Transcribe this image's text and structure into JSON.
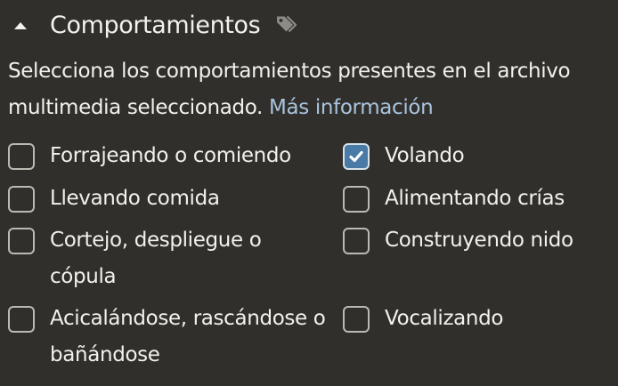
{
  "section": {
    "title": "Comportamientos",
    "description": "Selecciona los comportamientos presentes en el archivo multimedia seleccionado.",
    "more_info_link": "Más información"
  },
  "behaviors": {
    "foraging": {
      "label": "Forrajeando o comiendo",
      "checked": false
    },
    "flying": {
      "label": "Volando",
      "checked": true
    },
    "carrying_food": {
      "label": "Llevando comida",
      "checked": false
    },
    "feeding_young": {
      "label": "Alimentando crías",
      "checked": false
    },
    "courtship": {
      "label": "Cortejo, despliegue o cópula",
      "checked": false
    },
    "nest_building": {
      "label": "Construyendo nido",
      "checked": false
    },
    "preening": {
      "label": "Acicalándose, rascándose o bañándose",
      "checked": false
    },
    "vocalizing": {
      "label": "Vocalizando",
      "checked": false
    }
  },
  "icons": {
    "collapse": "caret-up-icon",
    "tag": "tag-icon",
    "check": "checkmark-icon"
  },
  "colors": {
    "background": "#312f2c",
    "text": "#f3f1ec",
    "link": "#a9c4dd",
    "checkbox_border": "#bdb9b2",
    "checkbox_checked": "#4a7ba7",
    "tag_icon": "#8e8a85"
  }
}
